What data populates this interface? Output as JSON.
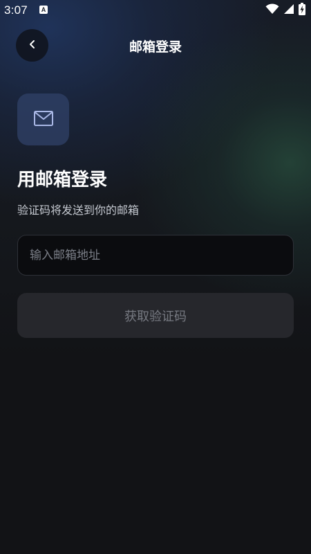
{
  "status_bar": {
    "time": "3:07",
    "notification_badge": "A",
    "icons": [
      "wifi-icon",
      "cellular-signal-icon",
      "battery-charging-icon"
    ]
  },
  "header": {
    "back_icon": "chevron-left-icon",
    "title": "邮箱登录"
  },
  "main": {
    "icon": "mail-icon",
    "heading": "用邮箱登录",
    "subheading": "验证码将发送到你的邮箱",
    "email_input": {
      "value": "",
      "placeholder": "输入邮箱地址"
    },
    "get_code_button": {
      "label": "获取验证码",
      "state": "disabled"
    }
  },
  "colors": {
    "background": "#121316",
    "accent_blue": "#304268",
    "accent_green": "#26483a",
    "icon_stroke": "#aab8e6",
    "button_bg": "#26272c",
    "button_text": "#777a82"
  }
}
